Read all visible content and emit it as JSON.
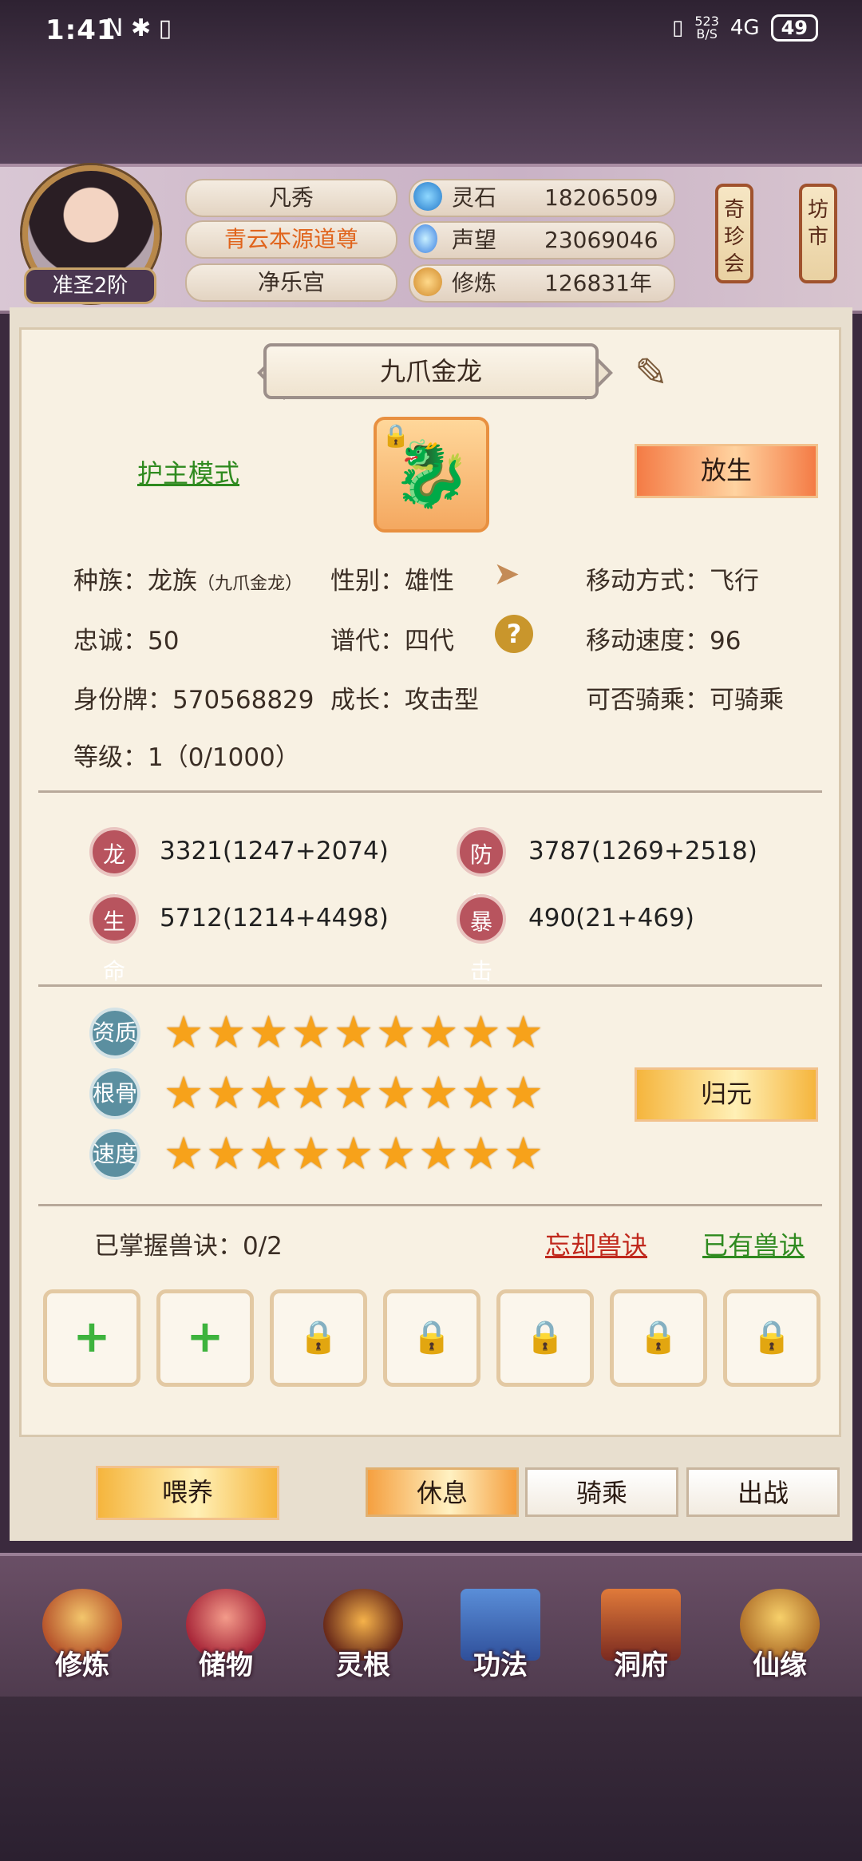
{
  "status_bar": {
    "time": "1:41",
    "left_icons": "N ✱ ▯",
    "net_speed_top": "523",
    "net_speed_bottom": "B/S",
    "signal": "4G",
    "battery": "49"
  },
  "header": {
    "rank": "准圣2阶",
    "pills": [
      "凡秀",
      "青云本源道尊",
      "净乐宫"
    ],
    "resources": [
      {
        "icon": "spirit-stone-icon",
        "label": "灵石",
        "value": "18206509"
      },
      {
        "icon": "reputation-icon",
        "label": "声望",
        "value": "23069046"
      },
      {
        "icon": "cultivation-icon",
        "label": "修炼",
        "value": "126831年"
      }
    ],
    "lanterns": [
      "奇珍会",
      "坊市"
    ]
  },
  "pet": {
    "name": "九爪金龙",
    "mode_link": "护主模式",
    "release_button": "放生",
    "info": {
      "race_label": "种族：",
      "race_value": "龙族",
      "race_sub": "（九爪金龙）",
      "gender": "性别：雄性",
      "move_type": "移动方式：飞行",
      "loyalty": "忠诚：50",
      "generation": "谱代：四代",
      "move_speed": "移动速度：96",
      "id_tag": "身份牌：570568829",
      "growth": "成长：攻击型",
      "rideable": "可否骑乘：可骑乘",
      "level": "等级：1（0/1000）"
    },
    "stats": [
      {
        "badge": "龙攻",
        "value": "3321(1247+2074)"
      },
      {
        "badge": "防御",
        "value": "3787(1269+2518)"
      },
      {
        "badge": "生命",
        "value": "5712(1214+4498)"
      },
      {
        "badge": "暴击",
        "value": "490(21+469)"
      }
    ],
    "attributes": [
      {
        "badge": "资质",
        "stars": "★★★★★★★★★",
        "rating": 9
      },
      {
        "badge": "根骨",
        "stars": "★★★★★★★★★",
        "rating": 9
      },
      {
        "badge": "速度",
        "stars": "★★★★★★★★★",
        "rating": 9
      }
    ],
    "return_button": "归元",
    "skills_label": "已掌握兽诀：0/2",
    "forget_link": "忘却兽诀",
    "owned_link": "已有兽诀",
    "slots": [
      "+",
      "+",
      "lock",
      "lock",
      "lock",
      "lock",
      "lock"
    ]
  },
  "actions": {
    "feed": "喂养",
    "rest": "休息",
    "ride": "骑乘",
    "battle": "出战"
  },
  "bottom_nav": [
    "修炼",
    "储物",
    "灵根",
    "功法",
    "洞府",
    "仙缘"
  ]
}
